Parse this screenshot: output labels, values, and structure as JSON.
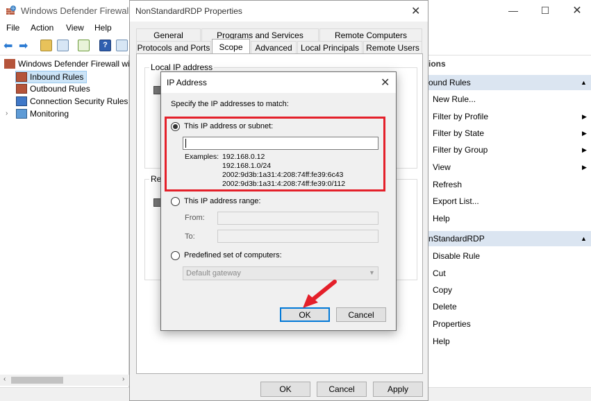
{
  "main_window": {
    "title": "Windows Defender Firewall wi",
    "menu": [
      "File",
      "Action",
      "View",
      "Help"
    ],
    "tree": [
      {
        "label": "Windows Defender Firewall wit"
      },
      {
        "label": "Inbound Rules"
      },
      {
        "label": "Outbound Rules"
      },
      {
        "label": "Connection Security Rules"
      },
      {
        "label": "Monitoring"
      }
    ],
    "actions": {
      "pane_title": "ions",
      "section1_title": "ound Rules",
      "section1_items": [
        {
          "label": "New Rule...",
          "has_submenu": false
        },
        {
          "label": "Filter by Profile",
          "has_submenu": true
        },
        {
          "label": "Filter by State",
          "has_submenu": true
        },
        {
          "label": "Filter by Group",
          "has_submenu": true
        },
        {
          "label": "View",
          "has_submenu": true
        },
        {
          "label": "Refresh",
          "has_submenu": false
        },
        {
          "label": "Export List...",
          "has_submenu": false
        },
        {
          "label": "Help",
          "has_submenu": false
        }
      ],
      "section2_title": "nStandardRDP",
      "section2_items": [
        {
          "label": "Disable Rule"
        },
        {
          "label": "Cut"
        },
        {
          "label": "Copy"
        },
        {
          "label": "Delete"
        },
        {
          "label": "Properties"
        },
        {
          "label": "Help"
        }
      ]
    }
  },
  "properties_dialog": {
    "title": "NonStandardRDP Properties",
    "tabs_row1": [
      "General",
      "Programs and Services",
      "Remote Computers"
    ],
    "tabs_row2": [
      "Protocols and Ports",
      "Scope",
      "Advanced",
      "Local Principals",
      "Remote Users"
    ],
    "active_tab": "Scope",
    "local_group_label": "Local IP address",
    "remote_group_label": "Re",
    "ok_label": "OK",
    "cancel_label": "Cancel",
    "apply_label": "Apply"
  },
  "ip_dialog": {
    "title": "IP Address",
    "instruction": "Specify the IP addresses to match:",
    "option_subnet": "This IP address or subnet:",
    "subnet_value": "",
    "examples_label": "Examples:",
    "examples": [
      "192.168.0.12",
      "192.168.1.0/24",
      "2002:9d3b:1a31:4:208:74ff:fe39:6c43",
      "2002:9d3b:1a31:4:208:74ff:fe39:0/112"
    ],
    "option_range": "This IP address range:",
    "from_label": "From:",
    "to_label": "To:",
    "option_predefined": "Predefined set of computers:",
    "predefined_value": "Default gateway",
    "selected_option": "subnet",
    "ok_label": "OK",
    "cancel_label": "Cancel"
  },
  "colors": {
    "highlight": "#e4202a",
    "accent": "#0078d7",
    "actions_header": "#dbe5f1"
  }
}
